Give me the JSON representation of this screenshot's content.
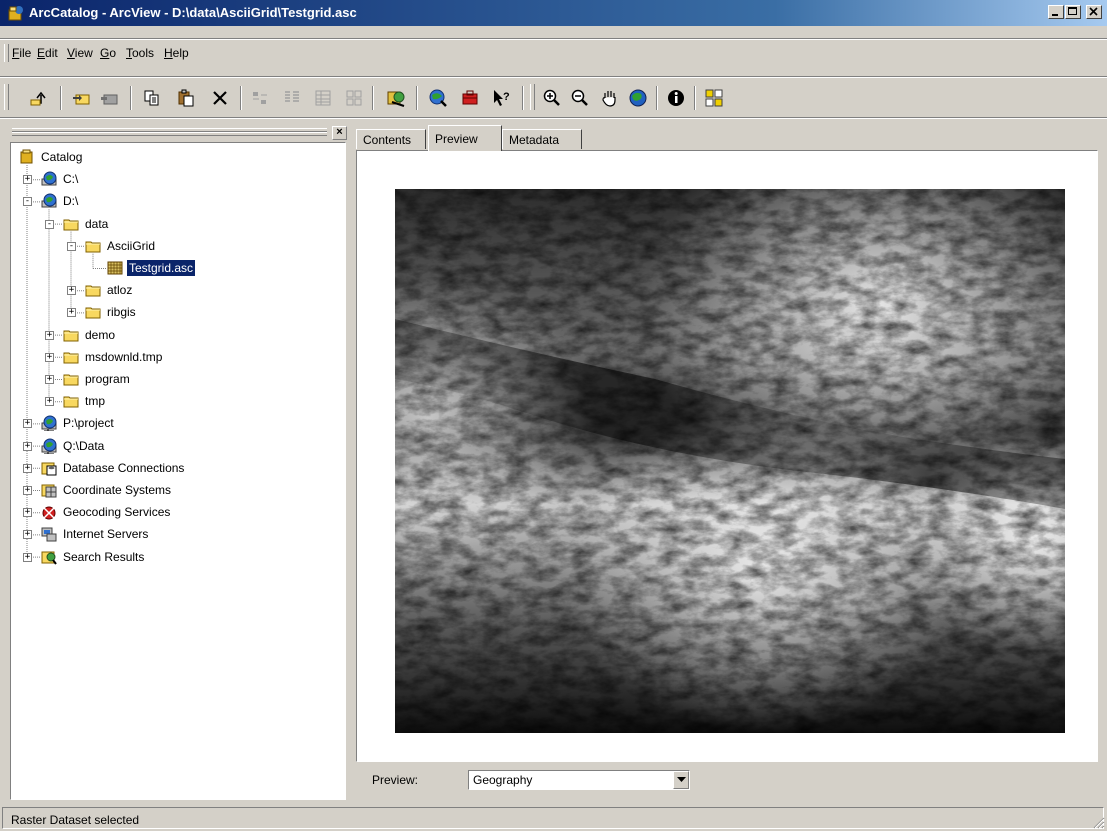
{
  "window": {
    "title": "ArcCatalog - ArcView - D:\\data\\AsciiGrid\\Testgrid.asc"
  },
  "menu": [
    {
      "label": "File",
      "key": "F",
      "rest": "ile"
    },
    {
      "label": "Edit",
      "key": "E",
      "rest": "dit"
    },
    {
      "label": "View",
      "key": "V",
      "rest": "iew"
    },
    {
      "label": "Go",
      "key": "G",
      "rest": "o"
    },
    {
      "label": "Tools",
      "key": "T",
      "rest": "ools"
    },
    {
      "label": "Help",
      "key": "H",
      "rest": "elp"
    }
  ],
  "toolbar": {
    "buttons": [
      "up-one-level",
      "connect-to-folder",
      "disconnect-from-folder",
      "copy",
      "paste",
      "delete",
      "large-icons",
      "list",
      "details",
      "thumbnails",
      "launch-arcmap",
      "arctoolbox",
      "show-hide-arctoolbox",
      "whats-this",
      "zoom-in",
      "zoom-out",
      "pan",
      "full-extent",
      "identify",
      "create-thumbnail"
    ]
  },
  "tree": {
    "items": [
      {
        "label": "Catalog",
        "icon": "catalog-icon",
        "level": 0,
        "expander": ""
      },
      {
        "label": "C:\\",
        "icon": "drive-icon",
        "level": 1,
        "expander": "+"
      },
      {
        "label": "D:\\",
        "icon": "drive-icon",
        "level": 1,
        "expander": "-"
      },
      {
        "label": "data",
        "icon": "folder-icon",
        "level": 2,
        "expander": "-"
      },
      {
        "label": "AsciiGrid",
        "icon": "folder-icon",
        "level": 3,
        "expander": "-"
      },
      {
        "label": "Testgrid.asc",
        "icon": "raster-icon",
        "level": 4,
        "expander": "",
        "selected": true
      },
      {
        "label": "atloz",
        "icon": "folder-icon",
        "level": 3,
        "expander": "+"
      },
      {
        "label": "ribgis",
        "icon": "folder-icon",
        "level": 3,
        "expander": "+"
      },
      {
        "label": "demo",
        "icon": "folder-icon",
        "level": 2,
        "expander": "+"
      },
      {
        "label": "msdownld.tmp",
        "icon": "folder-icon",
        "level": 2,
        "expander": "+"
      },
      {
        "label": "program",
        "icon": "folder-icon",
        "level": 2,
        "expander": "+"
      },
      {
        "label": "tmp",
        "icon": "folder-icon",
        "level": 2,
        "expander": "+"
      },
      {
        "label": "P:\\project",
        "icon": "network-drive-icon",
        "level": 1,
        "expander": "+"
      },
      {
        "label": "Q:\\Data",
        "icon": "network-drive-icon",
        "level": 1,
        "expander": "+"
      },
      {
        "label": "Database Connections",
        "icon": "database-connections-icon",
        "level": 1,
        "expander": "+"
      },
      {
        "label": "Coordinate Systems",
        "icon": "coordinate-systems-icon",
        "level": 1,
        "expander": "+"
      },
      {
        "label": "Geocoding Services",
        "icon": "geocoding-services-icon",
        "level": 1,
        "expander": "+"
      },
      {
        "label": "Internet Servers",
        "icon": "internet-servers-icon",
        "level": 1,
        "expander": "+"
      },
      {
        "label": "Search Results",
        "icon": "search-results-icon",
        "level": 1,
        "expander": "+"
      }
    ]
  },
  "tabs": [
    {
      "label": "Contents",
      "active": false
    },
    {
      "label": "Preview",
      "active": true
    },
    {
      "label": "Metadata",
      "active": false
    }
  ],
  "preview": {
    "label": "Preview:",
    "selected": "Geography",
    "image": "grayscale-elevation-raster"
  },
  "status": {
    "text": "Raster Dataset selected"
  },
  "colors": {
    "titlebar_start": "#0a246a",
    "titlebar_end": "#a6caf0",
    "face": "#d4d0c8",
    "selection": "#0a246a",
    "folder": "#f8d860"
  }
}
